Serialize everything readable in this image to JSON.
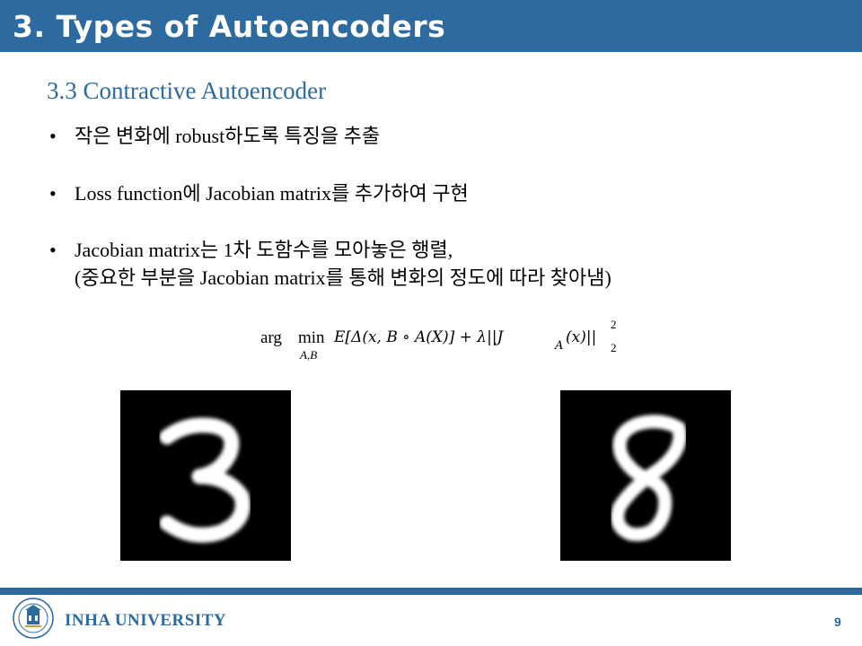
{
  "slide": {
    "title": "3. Types of Autoencoders",
    "subtitle": "3.3 Contractive Autoencoder",
    "bullets": [
      {
        "lines": [
          "작은 변화에 robust하도록 특징을 추출"
        ]
      },
      {
        "lines": [
          "Loss function에 Jacobian matrix를 추가하여 구현"
        ]
      },
      {
        "lines": [
          "Jacobian matrix는 1차 도함수를 모아놓은 행렬,",
          "(중요한 부분을 Jacobian matrix를 통해 변화의 정도에 따라 찾아냄)"
        ]
      }
    ],
    "bullet_symbol": "•",
    "formula": {
      "arg": "arg",
      "min": "min",
      "min_sub": "A,B",
      "body": "E[Δ(x, B  ∘ A(X)] + λ||J",
      "j_sub": "A",
      "tail": "(x)||",
      "norm_sup": "2",
      "norm_sub": "2"
    },
    "images": [
      {
        "name": "mnist-digit-three",
        "digit": "3"
      },
      {
        "name": "mnist-digit-eight",
        "digit": "8"
      }
    ],
    "footer": {
      "university": "INHA UNIVERSITY",
      "page_number": "9"
    }
  },
  "colors": {
    "brand_blue": "#2c6aa0",
    "image_bg": "#000000",
    "digit_stroke": "#ffffff"
  }
}
